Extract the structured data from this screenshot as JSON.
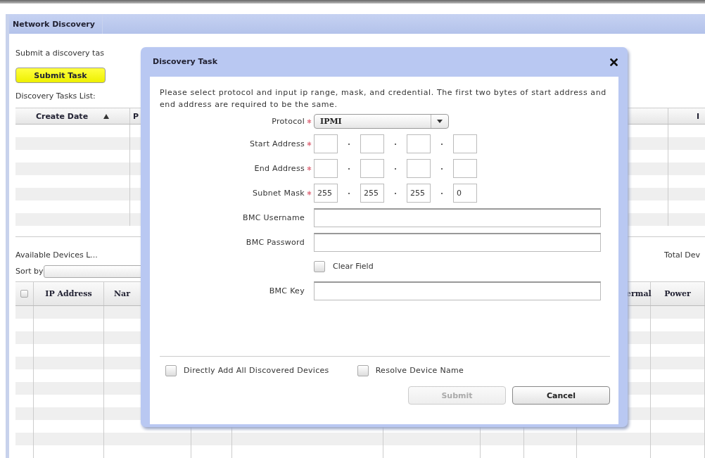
{
  "app_tab": {
    "label": "Network Discovery",
    "selected": true
  },
  "task_section": {
    "intro": "Submit a discovery tas",
    "submit_button": "Submit Task",
    "list_title": "Discovery Tasks List:"
  },
  "tasks_table": {
    "columns": [
      {
        "label": "Create Date",
        "sorted": true
      },
      {
        "label": "P",
        "sorted": false
      },
      {
        "label": "I",
        "sorted": false
      }
    ]
  },
  "devices_section": {
    "title": "Available Devices L...",
    "total_label": "Total Dev",
    "sort_label": "Sort by",
    "select_all_checked": false,
    "columns": [
      "IP Address",
      "Nar",
      "ermal",
      "Power"
    ]
  },
  "dialog": {
    "title": "Discovery Task",
    "instructions": "Please select protocol and input ip range, mask, and credential. The first two bytes of start address and end address are required to be the same.",
    "fields": [
      {
        "kind": "select",
        "label": "Protocol",
        "required": true,
        "value": "IPMI"
      },
      {
        "kind": "ip",
        "label": "Start Address",
        "required": true
      },
      {
        "kind": "ip",
        "label": "End Address",
        "required": true
      },
      {
        "kind": "ip",
        "label": "Subnet Mask",
        "required": true,
        "octets": [
          "255",
          "255",
          "255",
          "0"
        ]
      },
      {
        "kind": "text",
        "label": "BMC Username",
        "required": false
      },
      {
        "kind": "text",
        "label": "BMC Password",
        "required": false
      },
      {
        "kind": "checkbox",
        "label": "Clear Field",
        "checked": false
      },
      {
        "kind": "text",
        "label": "BMC Key",
        "required": false
      }
    ],
    "options": [
      {
        "label": "Directly Add All Discovered Devices",
        "checked": false
      },
      {
        "label": "Resolve Device Name",
        "checked": false
      }
    ],
    "buttons": [
      {
        "label": "Submit",
        "disabled": true
      },
      {
        "label": "Cancel",
        "disabled": false
      }
    ]
  }
}
